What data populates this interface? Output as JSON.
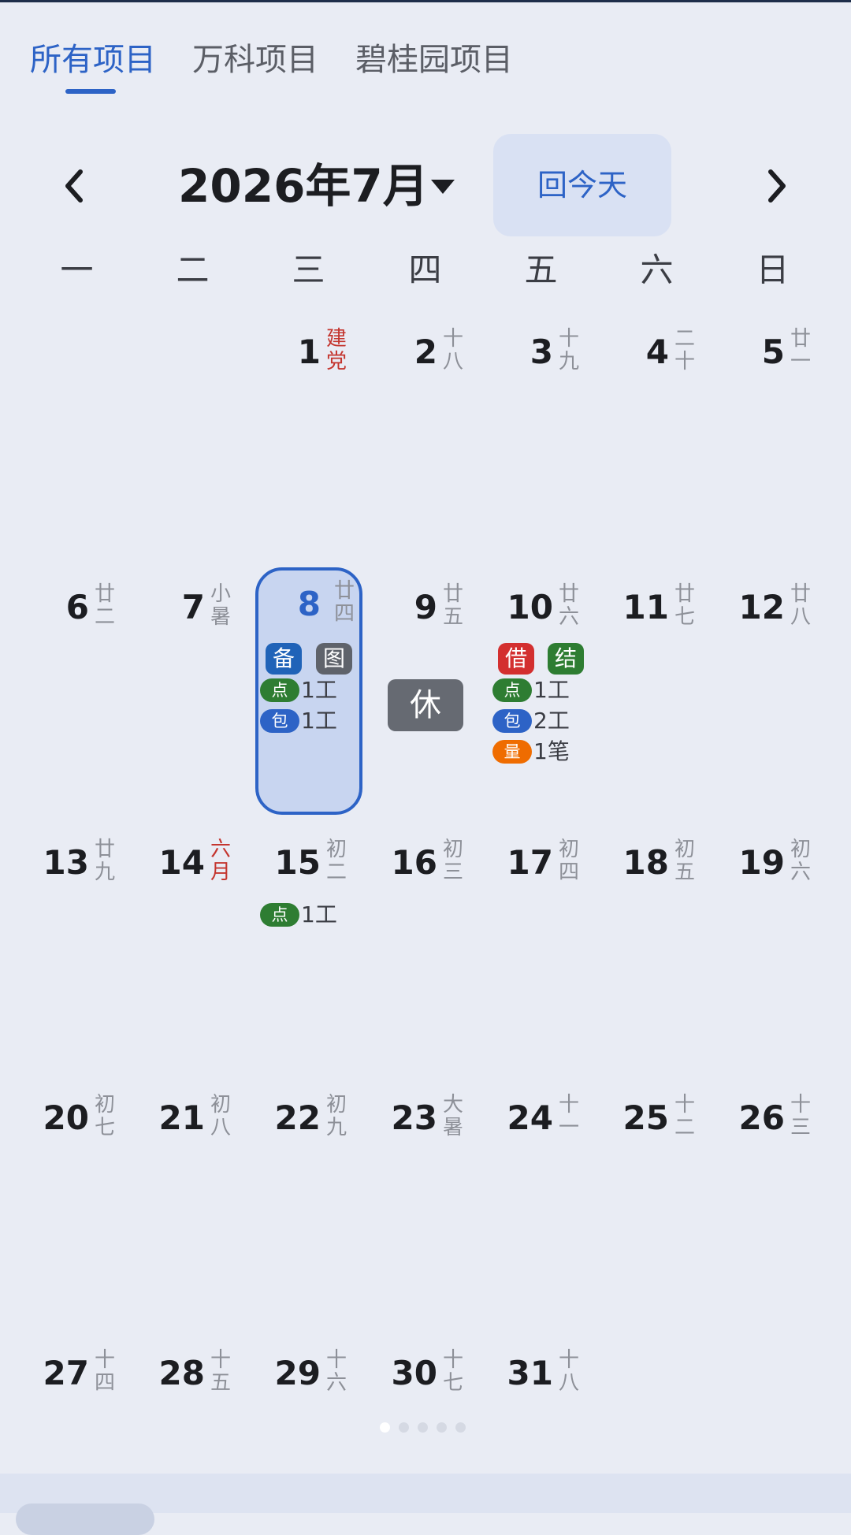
{
  "tabs": [
    "所有项目",
    "万科项目",
    "碧桂园项目"
  ],
  "active_tab": 0,
  "header": {
    "month_title": "2026年7月",
    "today_button": "回今天"
  },
  "icons": {
    "prev": "chevron-left-icon",
    "next": "chevron-right-icon",
    "dropdown": "caret-down-icon"
  },
  "weekdays": [
    "一",
    "二",
    "三",
    "四",
    "五",
    "六",
    "日"
  ],
  "days": [
    {
      "num": "1",
      "lunar": "建党",
      "lunar_red": true
    },
    {
      "num": "2",
      "lunar": "十八"
    },
    {
      "num": "3",
      "lunar": "十九"
    },
    {
      "num": "4",
      "lunar": "二十"
    },
    {
      "num": "5",
      "lunar": "廿一"
    },
    {
      "num": "6",
      "lunar": "廿二"
    },
    {
      "num": "7",
      "lunar": "小暑"
    },
    {
      "num": "8",
      "lunar": "廿四",
      "selected": true
    },
    {
      "num": "9",
      "lunar": "廿五",
      "rest": true
    },
    {
      "num": "10",
      "lunar": "廿六"
    },
    {
      "num": "11",
      "lunar": "廿七"
    },
    {
      "num": "12",
      "lunar": "廿八"
    },
    {
      "num": "13",
      "lunar": "廿九"
    },
    {
      "num": "14",
      "lunar": "六月",
      "lunar_red": true
    },
    {
      "num": "15",
      "lunar": "初二"
    },
    {
      "num": "16",
      "lunar": "初三"
    },
    {
      "num": "17",
      "lunar": "初四"
    },
    {
      "num": "18",
      "lunar": "初五"
    },
    {
      "num": "19",
      "lunar": "初六"
    },
    {
      "num": "20",
      "lunar": "初七"
    },
    {
      "num": "21",
      "lunar": "初八"
    },
    {
      "num": "22",
      "lunar": "初九"
    },
    {
      "num": "23",
      "lunar": "大暑"
    },
    {
      "num": "24",
      "lunar": "十一"
    },
    {
      "num": "25",
      "lunar": "十二"
    },
    {
      "num": "26",
      "lunar": "十三"
    },
    {
      "num": "27",
      "lunar": "十四"
    },
    {
      "num": "28",
      "lunar": "十五"
    },
    {
      "num": "29",
      "lunar": "十六"
    },
    {
      "num": "30",
      "lunar": "十七"
    },
    {
      "num": "31",
      "lunar": "十八"
    }
  ],
  "events": {
    "day8": {
      "badges": [
        {
          "label": "备",
          "color": "#2063b8"
        },
        {
          "label": "图",
          "color": "#5f636b"
        }
      ],
      "rows": [
        {
          "pill": "点",
          "color": "#2e7d32",
          "text": "1工"
        },
        {
          "pill": "包",
          "color": "#2d63c6",
          "text": "1工"
        }
      ]
    },
    "day9": {
      "rest_label": "休"
    },
    "day10": {
      "badges": [
        {
          "label": "借",
          "color": "#d32f2f"
        },
        {
          "label": "结",
          "color": "#2e7d32"
        }
      ],
      "rows": [
        {
          "pill": "点",
          "color": "#2e7d32",
          "text": "1工"
        },
        {
          "pill": "包",
          "color": "#2d63c6",
          "text": "2工"
        },
        {
          "pill": "量",
          "color": "#ef6c00",
          "text": "1笔"
        }
      ]
    },
    "day15": {
      "rows": [
        {
          "pill": "点",
          "color": "#2e7d32",
          "text": "1工"
        }
      ]
    }
  },
  "page_indicator": {
    "count": 5,
    "active": 0
  },
  "colors": {
    "accent": "#2d63c6",
    "background": "#e9ecf4",
    "today_bg": "#d9e1f3",
    "selected_bg": "#c8d5f0",
    "holiday_red": "#c4352e"
  }
}
